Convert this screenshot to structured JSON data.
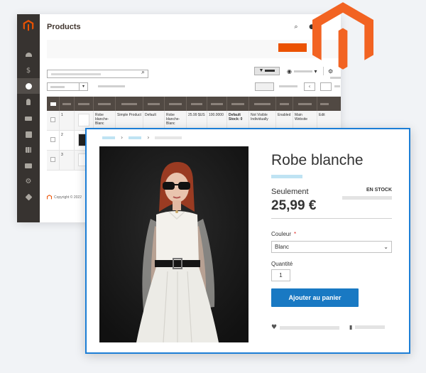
{
  "colors": {
    "sidebar": "#373330",
    "brand_orange": "#eb5202",
    "primary_blue": "#1979c3",
    "frame_blue": "#1c7ed6",
    "grid_header": "#514943"
  },
  "admin": {
    "page_title": "Products",
    "sidebar_icons": [
      "dashboard-icon",
      "sales-icon",
      "catalog-icon",
      "customers-icon",
      "marketing-icon",
      "content-icon",
      "reports-icon",
      "stores-icon",
      "system-icon",
      "extensions-icon"
    ],
    "grid": {
      "rows": [
        {
          "id": "1",
          "name": "Robe blanche-Blanc",
          "type": "Simple Product",
          "attr_set": "Default",
          "sku": "Robe blanche-Blanc",
          "price": "25.99 $US",
          "qty": "100.0000",
          "salable": "Default Stock: 0",
          "visibility": "Not Visible Individually",
          "status": "Enabled",
          "websites": "Main Website",
          "action": "Edit"
        },
        {
          "id": "2",
          "name": "",
          "type": "",
          "attr_set": "",
          "sku": "",
          "price": "",
          "qty": "",
          "salable": "",
          "visibility": "",
          "status": "",
          "websites": "",
          "action": ""
        },
        {
          "id": "3",
          "name": "",
          "type": "",
          "attr_set": "",
          "sku": "",
          "price": "",
          "qty": "",
          "salable": "",
          "visibility": "",
          "status": "",
          "websites": "",
          "action": ""
        }
      ]
    },
    "footer": {
      "copyright": "Copyright © 2022"
    }
  },
  "product": {
    "title": "Robe blanche",
    "price_label": "Seulement",
    "price": "25,99 €",
    "stock": "EN STOCK",
    "color_label": "Couleur",
    "required_mark": "*",
    "color_value": "Blanc",
    "qty_label": "Quantité",
    "qty_value": "1",
    "add_to_cart": "Ajouter au panier"
  }
}
